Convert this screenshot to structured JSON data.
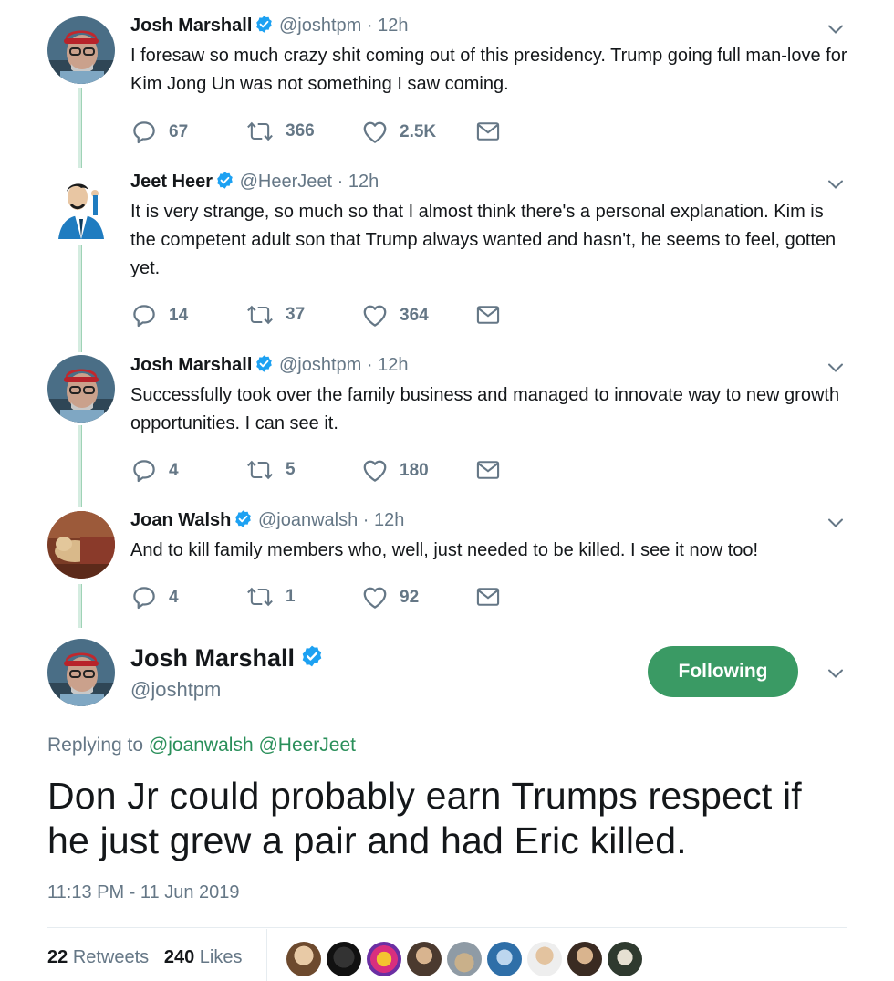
{
  "thread": [
    {
      "name": "Josh Marshall",
      "handle": "@joshtpm",
      "sep": "·",
      "time": "12h",
      "text": "I foresaw so much crazy shit coming out of this presidency. Trump going full man-love for Kim Jong Un was not something I saw coming.",
      "replies": "67",
      "retweets": "366",
      "likes": "2.5K"
    },
    {
      "name": "Jeet Heer",
      "handle": "@HeerJeet",
      "sep": "·",
      "time": "12h",
      "text": "It is very strange, so much so that I almost think there's a personal explanation. Kim is the competent adult son that Trump always wanted and hasn't, he seems to feel, gotten yet.",
      "replies": "14",
      "retweets": "37",
      "likes": "364"
    },
    {
      "name": "Josh Marshall",
      "handle": "@joshtpm",
      "sep": "·",
      "time": "12h",
      "text": "Successfully took over the family business and managed to innovate way to new growth opportunities. I can see it.",
      "replies": "4",
      "retweets": "5",
      "likes": "180"
    },
    {
      "name": "Joan Walsh",
      "handle": "@joanwalsh",
      "sep": "·",
      "time": "12h",
      "text": "And to kill family members who, well, just needed to be killed. I see it now too!",
      "replies": "4",
      "retweets": "1",
      "likes": "92"
    }
  ],
  "main": {
    "name": "Josh Marshall",
    "handle": "@joshtpm",
    "follow_label": "Following",
    "replying_prefix": "Replying to",
    "replying_to": [
      "@joanwalsh",
      "@HeerJeet"
    ],
    "text": "Don Jr could probably earn Trumps respect if he just grew a pair and had Eric killed.",
    "timestamp": "11:13 PM - 11 Jun 2019",
    "retweets_count": "22",
    "retweets_label": "Retweets",
    "likes_count": "240",
    "likes_label": "Likes"
  },
  "colors": {
    "accent_green": "#3a9a64",
    "link_green": "#2a8f5a",
    "verified_blue": "#1da1f2",
    "muted": "#657786"
  },
  "icons": [
    "reply-icon",
    "retweet-icon",
    "like-icon",
    "message-icon",
    "verified-icon",
    "caret-down-icon"
  ]
}
